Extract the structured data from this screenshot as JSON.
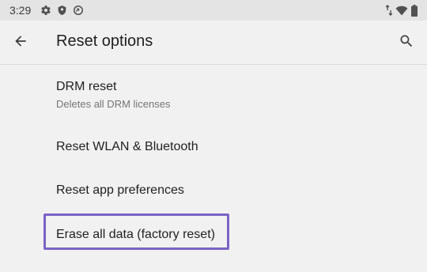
{
  "status_bar": {
    "time": "3:29",
    "left_icons": [
      "settings-icon",
      "shield-icon",
      "data-saver-icon"
    ],
    "right_icons": [
      "data-arrows-icon",
      "wifi-icon",
      "battery-icon"
    ]
  },
  "app_bar": {
    "title": "Reset options",
    "back_icon": "arrow-back-icon",
    "search_icon": "search-icon"
  },
  "items": [
    {
      "title": "DRM reset",
      "summary": "Deletes all DRM licenses"
    },
    {
      "title": "Reset WLAN & Bluetooth"
    },
    {
      "title": "Reset app preferences"
    },
    {
      "title": "Erase all data (factory reset)",
      "highlighted": true
    }
  ],
  "colors": {
    "background": "#f1f1f1",
    "status_bar": "#e4e4e4",
    "highlight": "#7b63c6",
    "summary_text": "#757575"
  }
}
